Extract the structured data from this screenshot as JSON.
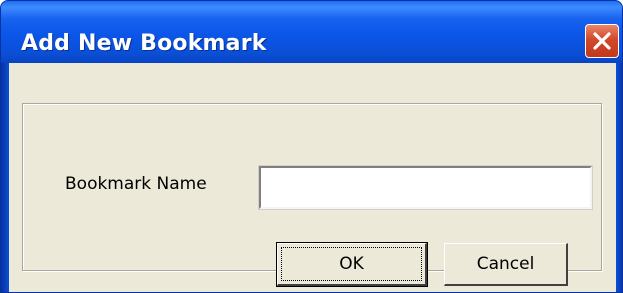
{
  "window": {
    "title": "Add New Bookmark"
  },
  "form": {
    "name_label": "Bookmark Name",
    "name_value": "",
    "name_placeholder": ""
  },
  "buttons": {
    "ok_label": "OK",
    "cancel_label": "Cancel"
  },
  "icons": {
    "close": "close-icon"
  },
  "colors": {
    "titlebar": "#0a4fd8",
    "client_background": "#ece9d8",
    "close_button": "#d3482a"
  }
}
